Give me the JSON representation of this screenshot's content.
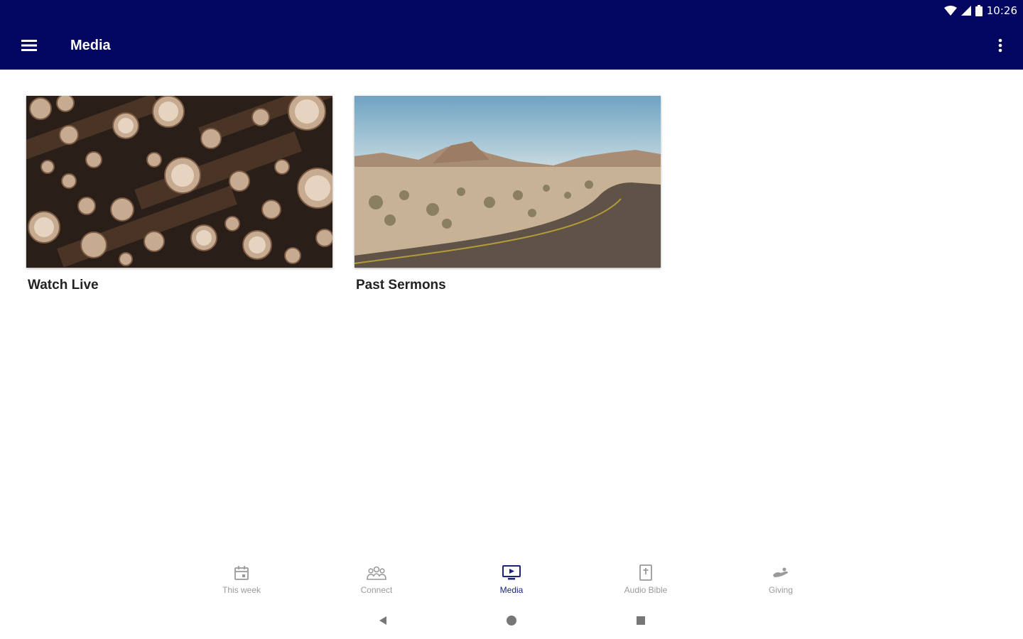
{
  "status_bar": {
    "time": "10:26"
  },
  "app_bar": {
    "title": "Media"
  },
  "cards": [
    {
      "label": "Watch Live"
    },
    {
      "label": "Past Sermons"
    }
  ],
  "bottom_nav": {
    "items": [
      {
        "label": "This week",
        "icon": "calendar-icon"
      },
      {
        "label": "Connect",
        "icon": "people-icon"
      },
      {
        "label": "Media",
        "icon": "monitor-play-icon",
        "active": true
      },
      {
        "label": "Audio Bible",
        "icon": "bible-icon"
      },
      {
        "label": "Giving",
        "icon": "giving-hand-icon"
      }
    ]
  },
  "colors": {
    "app_bar": "#020660",
    "active_nav": "#1a237e",
    "inactive_nav": "#9a9a9a"
  }
}
